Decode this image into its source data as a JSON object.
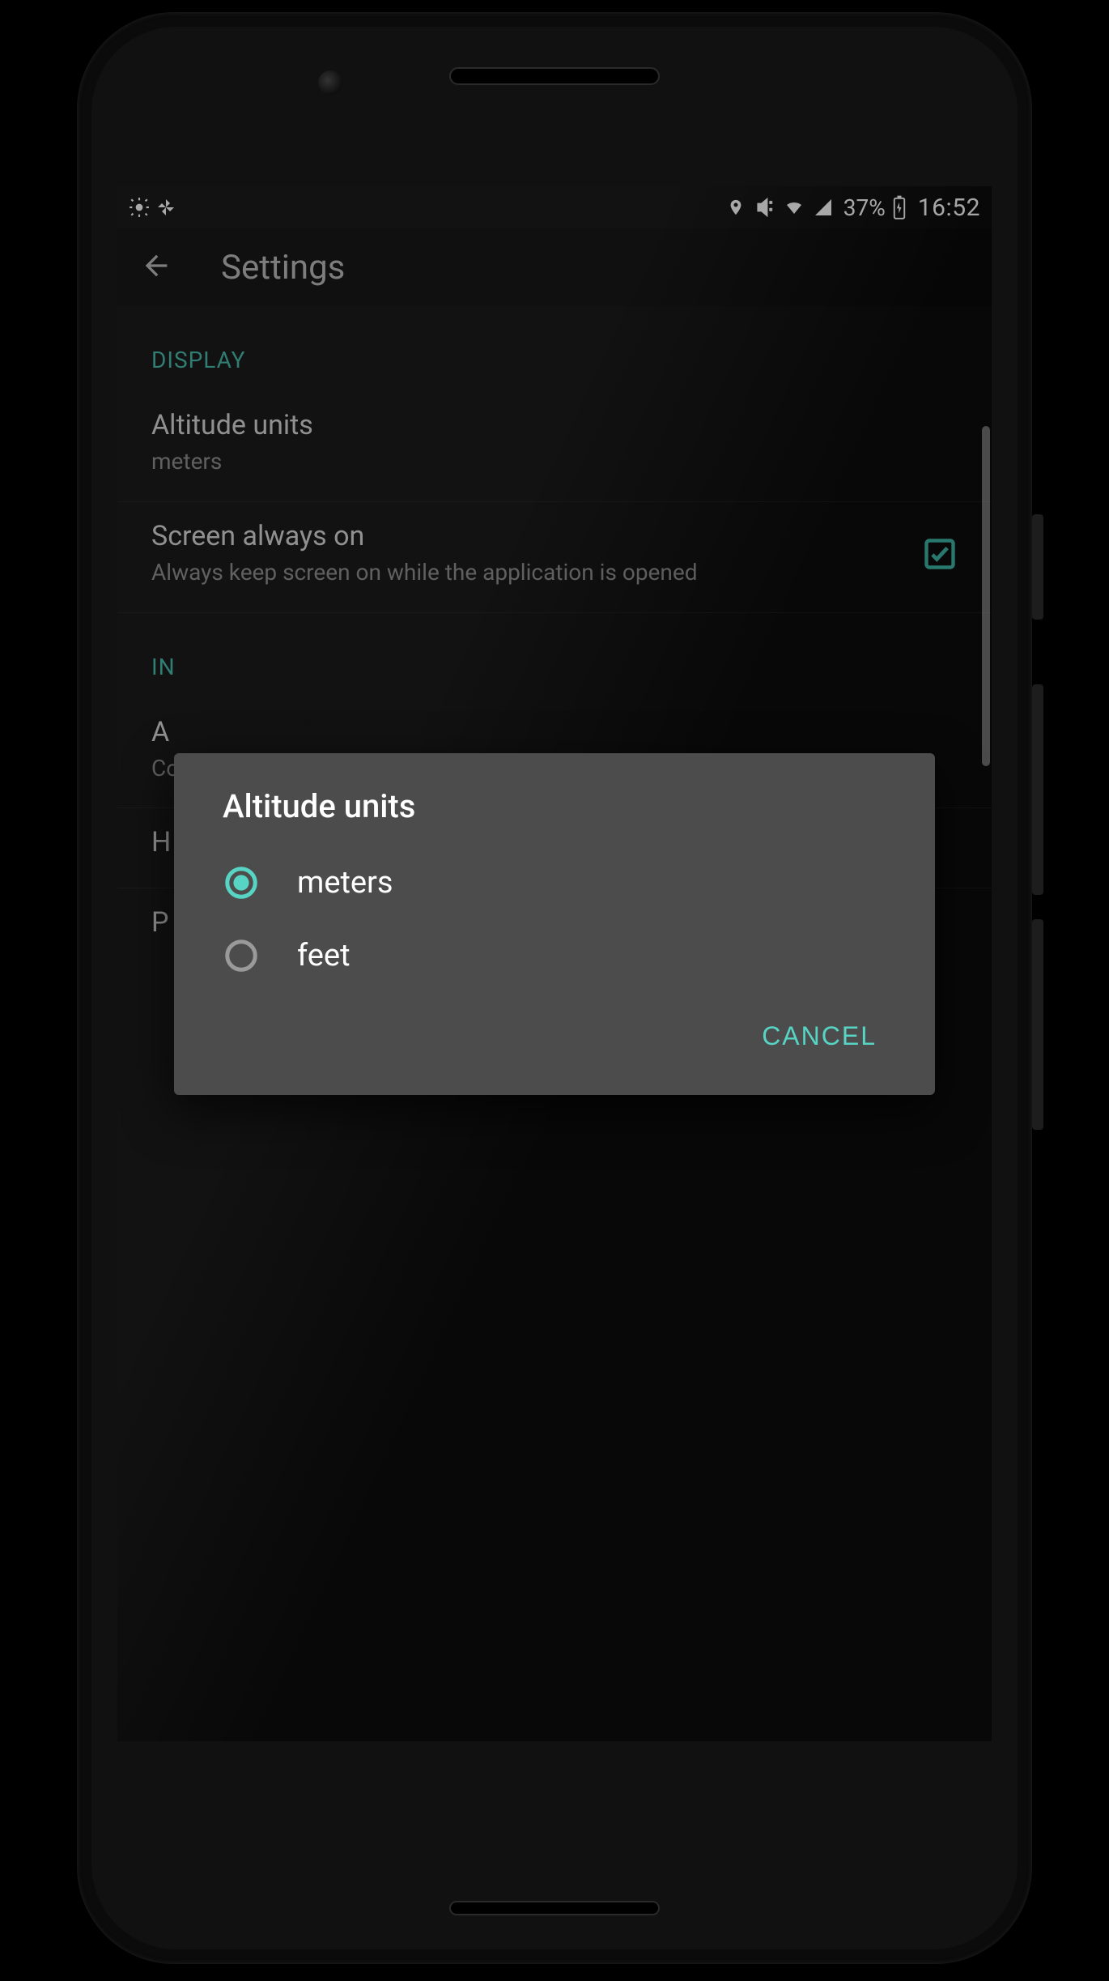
{
  "statusbar": {
    "battery_percent": "37%",
    "time": "16:52"
  },
  "appbar": {
    "title": "Settings"
  },
  "settings": {
    "section_display": "DISPLAY",
    "altitude_units": {
      "title": "Altitude units",
      "value": "meters"
    },
    "screen_always_on": {
      "title": "Screen always on",
      "subtitle": "Always keep screen on while the application is opened",
      "checked": true
    },
    "section_info_prefix": "IN",
    "row3_title_prefix": "A",
    "row3_sub_prefix": "Co",
    "row4_title_prefix": "H",
    "row5_title_prefix": "P"
  },
  "dialog": {
    "title": "Altitude units",
    "options": [
      {
        "label": "meters",
        "selected": true
      },
      {
        "label": "feet",
        "selected": false
      }
    ],
    "cancel": "CANCEL"
  },
  "colors": {
    "accent": "#3fb8a8"
  }
}
